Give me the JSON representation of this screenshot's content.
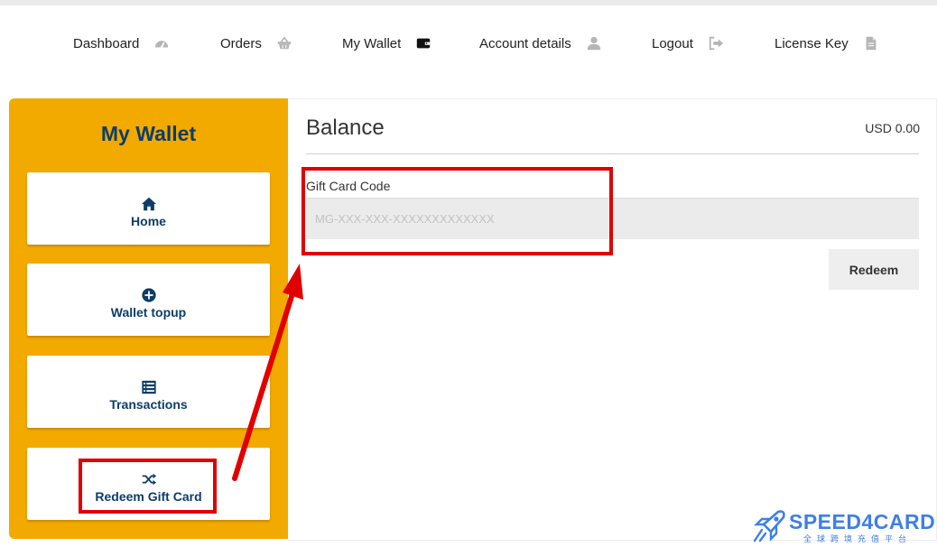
{
  "nav": {
    "items": [
      {
        "label": "Dashboard",
        "icon": "dashboard-icon"
      },
      {
        "label": "Orders",
        "icon": "basket-icon"
      },
      {
        "label": "My Wallet",
        "icon": "wallet-icon"
      },
      {
        "label": "Account details",
        "icon": "user-icon"
      },
      {
        "label": "Logout",
        "icon": "logout-icon"
      },
      {
        "label": "License Key",
        "icon": "document-icon"
      }
    ]
  },
  "sidebar": {
    "title": "My Wallet",
    "items": [
      {
        "label": "Home",
        "icon": "home-icon"
      },
      {
        "label": "Wallet topup",
        "icon": "plus-circle-icon"
      },
      {
        "label": "Transactions",
        "icon": "list-icon"
      },
      {
        "label": "Redeem Gift Card",
        "icon": "shuffle-icon"
      }
    ]
  },
  "main": {
    "balance_title": "Balance",
    "balance_amount": "USD 0.00",
    "gift_card_label": "Gift Card Code",
    "gift_card_placeholder": "MG-XXX-XXX-XXXXXXXXXXXXX",
    "gift_card_value": "",
    "redeem_label": "Redeem"
  },
  "watermark": {
    "brand": "SPEED4CARD",
    "tagline": "全球跨境充值平台"
  },
  "colors": {
    "sidebar_bg": "#f2a900",
    "navy_text": "#0d3d69",
    "highlight_red": "#e00000",
    "watermark_blue": "#3f7fe6"
  }
}
